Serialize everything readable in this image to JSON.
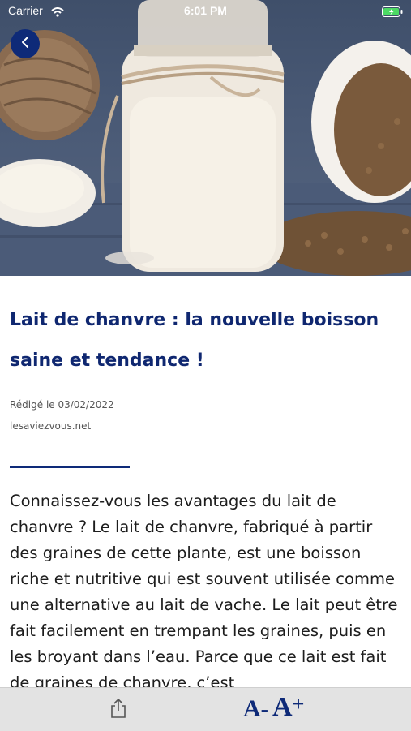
{
  "status_bar": {
    "carrier": "Carrier",
    "time": "6:01 PM"
  },
  "article": {
    "title": "Lait de chanvre : la nouvelle boisson saine et tendance !",
    "date_label": "Rédigé le 03/02/2022",
    "source": "lesaviezvous.net",
    "body": "Connaissez-vous les avantages du lait de chanvre ? Le lait de chanvre, fabriqué à partir des graines de cette plante, est une boisson riche et nutritive qui est souvent utilisée comme une alternative au lait de vache. Le lait peut être fait facilement en trempant les graines, puis en les broyant dans l’eau. Parce que ce lait est fait de graines de chanvre, c’est"
  },
  "toolbar": {
    "decrease_letter": "A",
    "decrease_sign": "-",
    "increase_letter": "A",
    "increase_sign": "+"
  },
  "icons": {
    "back": "chevron-left-icon",
    "share": "share-icon",
    "wifi": "wifi-icon",
    "battery": "battery-charging-icon"
  },
  "colors": {
    "brand_navy": "#0e2a78",
    "title": "#0f2770",
    "toolbar_bg": "#e3e3e3"
  }
}
